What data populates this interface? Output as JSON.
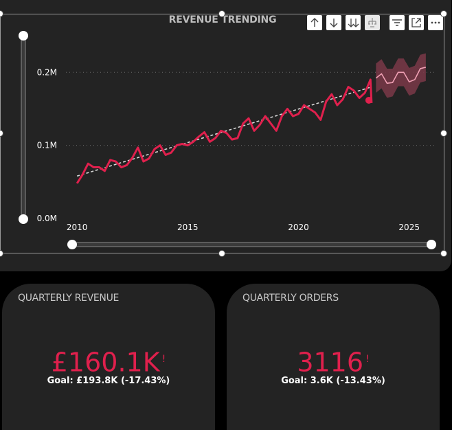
{
  "chart": {
    "title": "REVENUE TRENDING",
    "colors": {
      "series": "#e0204d",
      "forecast": "#f0a0b4",
      "band": "#7a3848",
      "trend": "#d8d8d8",
      "grid": "#6a6a6a",
      "text": "#ffffff"
    }
  },
  "toolbar": {
    "icons": [
      "drill-up-arrow-icon",
      "drill-down-arrow-icon",
      "expand-all-levels-icon",
      "expand-hierarchy-icon",
      "filter-icon",
      "focus-mode-icon",
      "more-options-icon"
    ]
  },
  "chart_data": {
    "type": "line",
    "title": "REVENUE TRENDING",
    "xlabel": "",
    "ylabel": "",
    "xlim": [
      2009.5,
      2026.25
    ],
    "ylim": [
      0,
      220000
    ],
    "x_ticks": [
      2010,
      2015,
      2020,
      2025
    ],
    "x_tick_labels": [
      "2010",
      "2015",
      "2020",
      "2025"
    ],
    "y_ticks": [
      0,
      100000,
      200000
    ],
    "y_tick_labels": [
      "0.0M",
      "0.1M",
      "0.2M"
    ],
    "grid": true,
    "series": [
      {
        "role": "actual",
        "x": [
          2010.0,
          2010.25,
          2010.5,
          2010.75,
          2011.0,
          2011.25,
          2011.5,
          2011.75,
          2012.0,
          2012.25,
          2012.5,
          2012.75,
          2013.0,
          2013.25,
          2013.5,
          2013.75,
          2014.0,
          2014.25,
          2014.5,
          2014.75,
          2015.0,
          2015.25,
          2015.5,
          2015.75,
          2016.0,
          2016.25,
          2016.5,
          2016.75,
          2017.0,
          2017.25,
          2017.5,
          2017.75,
          2018.0,
          2018.25,
          2018.5,
          2018.75,
          2019.0,
          2019.25,
          2019.5,
          2019.75,
          2020.0,
          2020.25,
          2020.5,
          2020.75,
          2021.0,
          2021.25,
          2021.5,
          2021.75,
          2022.0,
          2022.25,
          2022.5,
          2022.75,
          2023.0,
          2023.25
        ],
        "values": [
          48000,
          60000,
          75000,
          70000,
          70000,
          65000,
          80000,
          78000,
          70000,
          73000,
          83000,
          97000,
          78000,
          82000,
          95000,
          100000,
          87000,
          90000,
          100000,
          102000,
          100000,
          105000,
          112000,
          118000,
          105000,
          110000,
          120000,
          117000,
          108000,
          110000,
          130000,
          137000,
          120000,
          128000,
          140000,
          130000,
          120000,
          140000,
          150000,
          140000,
          143000,
          155000,
          150000,
          145000,
          135000,
          160000,
          170000,
          155000,
          163000,
          180000,
          175000,
          165000,
          172000,
          190000
        ]
      },
      {
        "role": "last-point",
        "x": [
          2023.3
        ],
        "values": [
          158000
        ]
      },
      {
        "role": "forecast",
        "x": [
          2023.5,
          2023.75,
          2024.0,
          2024.25,
          2024.5,
          2024.75,
          2025.0,
          2025.25,
          2025.5,
          2025.75
        ],
        "values": [
          192000,
          198000,
          185000,
          186000,
          200000,
          200000,
          187000,
          190000,
          205000,
          207000
        ],
        "lower": [
          172000,
          178000,
          165000,
          167000,
          181000,
          181000,
          168000,
          171000,
          186000,
          188000
        ],
        "upper": [
          212000,
          218000,
          205000,
          205000,
          219000,
          219000,
          206000,
          209000,
          224000,
          226000
        ]
      },
      {
        "role": "trend",
        "x": [
          2010.0,
          2023.3
        ],
        "values": [
          58000,
          180000
        ]
      }
    ]
  },
  "kpis": [
    {
      "title": "QUARTERLY REVENUE",
      "value": "£160.1K",
      "mark": "!",
      "goal": "Goal: £193.8K (-17.43%)"
    },
    {
      "title": "QUARTERLY ORDERS",
      "value": "3116",
      "mark": "!",
      "goal": "Goal: 3.6K (-13.43%)"
    }
  ]
}
